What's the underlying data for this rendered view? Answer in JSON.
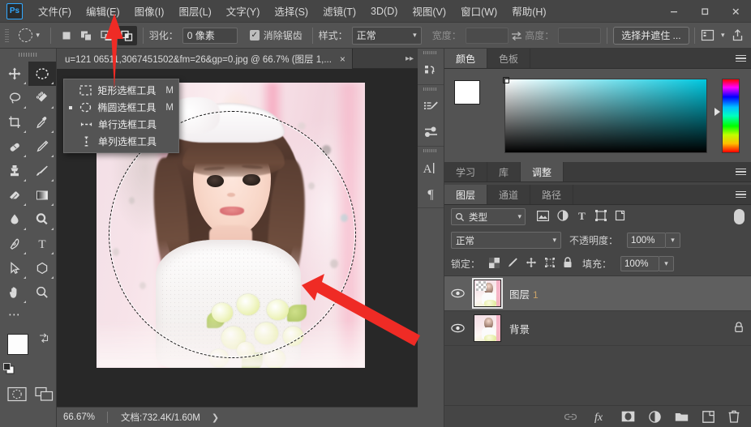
{
  "app": {
    "logo": "Ps",
    "title_bar_color": "#454545"
  },
  "menubar": {
    "items": [
      {
        "label": "文件(F)"
      },
      {
        "label": "编辑(E)"
      },
      {
        "label": "图像(I)"
      },
      {
        "label": "图层(L)"
      },
      {
        "label": "文字(Y)"
      },
      {
        "label": "选择(S)"
      },
      {
        "label": "滤镜(T)"
      },
      {
        "label": "3D(D)"
      },
      {
        "label": "视图(V)"
      },
      {
        "label": "窗口(W)"
      },
      {
        "label": "帮助(H)"
      }
    ],
    "window_controls": {
      "minimize": "minimize-icon",
      "maximize": "maximize-icon",
      "close": "close-icon"
    }
  },
  "optionsbar": {
    "tool_icon": "ellipse-marquee-icon",
    "tool_preset_chevron": "chevron-down-icon",
    "selection_modes": [
      {
        "name": "new-selection",
        "active": false
      },
      {
        "name": "add-to-selection",
        "active": false
      },
      {
        "name": "subtract-from-selection",
        "active": false
      },
      {
        "name": "intersect-with-selection",
        "active": true
      }
    ],
    "feather_label": "羽化：",
    "feather_value": "0 像素",
    "antialias_label": "消除锯齿",
    "antialias_checked": true,
    "style_label": "样式：",
    "style_value": "正常",
    "width_label": "宽度：",
    "width_value": "",
    "swap_icon": "swap-arrows-icon",
    "height_label": "高度：",
    "height_value": "",
    "select_and_mask": "选择并遮住 ...",
    "workspace_icon": "workspace-icon",
    "workspace_chevron": "chevron-down-icon",
    "share_icon": "share-export-icon"
  },
  "toolbar": {
    "tools": [
      {
        "name": "move-tool",
        "icon": "move-icon",
        "selected": false
      },
      {
        "name": "elliptical-marquee-tool",
        "icon": "ellipse-marquee-icon",
        "selected": true
      },
      {
        "name": "lasso-tool",
        "icon": "lasso-icon",
        "selected": false
      },
      {
        "name": "quick-selection-tool",
        "icon": "quick-selection-icon",
        "selected": false
      },
      {
        "name": "crop-tool",
        "icon": "crop-icon",
        "selected": false
      },
      {
        "name": "eyedropper-tool",
        "icon": "eyedropper-icon",
        "selected": false
      },
      {
        "name": "spot-healing-brush-tool",
        "icon": "healing-brush-icon",
        "selected": false
      },
      {
        "name": "brush-tool",
        "icon": "pencil-icon",
        "selected": false
      },
      {
        "name": "clone-stamp-tool",
        "icon": "clone-stamp-icon",
        "selected": false
      },
      {
        "name": "history-brush-tool",
        "icon": "history-brush-icon",
        "selected": false
      },
      {
        "name": "eraser-tool",
        "icon": "eraser-icon",
        "selected": false
      },
      {
        "name": "gradient-tool",
        "icon": "gradient-icon",
        "selected": false
      },
      {
        "name": "blur-tool",
        "icon": "blur-drop-icon",
        "selected": false
      },
      {
        "name": "dodge-tool",
        "icon": "dodge-icon",
        "selected": false
      },
      {
        "name": "pen-tool",
        "icon": "pen-icon",
        "selected": false
      },
      {
        "name": "type-tool",
        "icon": "type-T-icon",
        "selected": false
      },
      {
        "name": "path-selection-tool",
        "icon": "path-arrow-icon",
        "selected": false
      },
      {
        "name": "shape-tool",
        "icon": "polygon-icon",
        "selected": false
      },
      {
        "name": "hand-tool",
        "icon": "hand-icon",
        "selected": false
      },
      {
        "name": "zoom-tool",
        "icon": "magnifier-icon",
        "selected": false
      }
    ],
    "edit_toolbar_icon": "ellipsis-icon",
    "swatches": {
      "foreground_color": "#ffffff",
      "background_color": "#ffffff",
      "swap_icon": "swap-colors-icon",
      "default_icon": "default-colors-icon"
    },
    "quickmask_icon": "quick-mask-icon",
    "screenmode_icon": "screen-mode-icon"
  },
  "flyout_menu": {
    "items": [
      {
        "icon": "rectangular-marquee-icon",
        "label": "矩形选框工具",
        "shortcut": "M",
        "selected": false
      },
      {
        "icon": "elliptical-marquee-icon",
        "label": "椭圆选框工具",
        "shortcut": "M",
        "selected": true
      },
      {
        "icon": "single-row-marquee-icon",
        "label": "单行选框工具",
        "shortcut": "",
        "selected": false
      },
      {
        "icon": "single-column-marquee-icon",
        "label": "单列选框工具",
        "shortcut": "",
        "selected": false
      }
    ]
  },
  "document": {
    "tab_title": "u=121 06511,3067451502&fm=26&gp=0.jpg @ 66.7% (图层 1,...",
    "close_icon": "close-icon",
    "statusbar": {
      "zoom": "66.67%",
      "doc_info": "文档:732.4K/1.60M",
      "expand_icon": "chevron-right-icon"
    },
    "canvas": {
      "selection_shape": "ellipse",
      "image_description": "照片：戴蕾丝发带的小女孩，白色连衣裙，手捧黄白花束，粉色模糊背景"
    }
  },
  "icon_dock": {
    "items": [
      {
        "name": "history-panel-icon"
      },
      {
        "name": "brush-settings-icon"
      },
      {
        "name": "brush-presets-icon"
      },
      {
        "name": "character-panel-icon"
      },
      {
        "name": "paragraph-panel-icon"
      }
    ]
  },
  "color_panel": {
    "tabs": [
      {
        "label": "颜色",
        "active": true
      },
      {
        "label": "色板",
        "active": false
      }
    ],
    "menu_icon": "panel-menu-icon",
    "foreground_color": "#ffffff",
    "background_color": "#ffffff",
    "picker_hue": "#00c8e0"
  },
  "adjust_panel": {
    "tabs": [
      {
        "label": "学习",
        "active": false
      },
      {
        "label": "库",
        "active": false
      },
      {
        "label": "调整",
        "active": true
      }
    ],
    "menu_icon": "panel-menu-icon"
  },
  "layers_panel": {
    "tabs": [
      {
        "label": "图层",
        "active": true
      },
      {
        "label": "通道",
        "active": false
      },
      {
        "label": "路径",
        "active": false
      }
    ],
    "menu_icon": "panel-menu-icon",
    "filter": {
      "search_icon": "search-icon",
      "label": "类型",
      "chevron": "chevron-down-icon",
      "type_icons": [
        {
          "name": "filter-pixel-icon"
        },
        {
          "name": "filter-adjustment-icon"
        },
        {
          "name": "filter-type-icon"
        },
        {
          "name": "filter-shape-icon"
        },
        {
          "name": "filter-smart-object-icon"
        }
      ],
      "power_toggle": "filter-enable-toggle"
    },
    "blend_mode": "正常",
    "opacity_label": "不透明度：",
    "opacity_value": "100%",
    "lock_label": "锁定：",
    "lock_icons": [
      {
        "name": "lock-transparent-pixels-icon"
      },
      {
        "name": "lock-image-pixels-icon"
      },
      {
        "name": "lock-position-icon"
      },
      {
        "name": "lock-artboard-icon"
      },
      {
        "name": "lock-all-icon"
      }
    ],
    "fill_label": "填充：",
    "fill_value": "100%",
    "layers": [
      {
        "name": "图层",
        "suffix": "1",
        "visible": true,
        "selected": true,
        "locked": false,
        "has_transparency": true
      },
      {
        "name": "背景",
        "suffix": "",
        "visible": true,
        "selected": false,
        "locked": true,
        "has_transparency": false
      }
    ],
    "footer_icons": [
      {
        "name": "link-layers-icon"
      },
      {
        "name": "layer-style-fx-icon"
      },
      {
        "name": "add-layer-mask-icon"
      },
      {
        "name": "new-adjustment-layer-icon"
      },
      {
        "name": "new-group-icon"
      },
      {
        "name": "new-layer-icon"
      },
      {
        "name": "delete-layer-icon"
      }
    ]
  },
  "annotations": {
    "arrow_color": "#ef2b25",
    "arrows": [
      {
        "name": "annotation-arrow-top",
        "points_to": "rectangular-marquee-tool-menu-item"
      },
      {
        "name": "annotation-arrow-canvas",
        "points_to": "elliptical-selection-on-canvas"
      }
    ]
  }
}
